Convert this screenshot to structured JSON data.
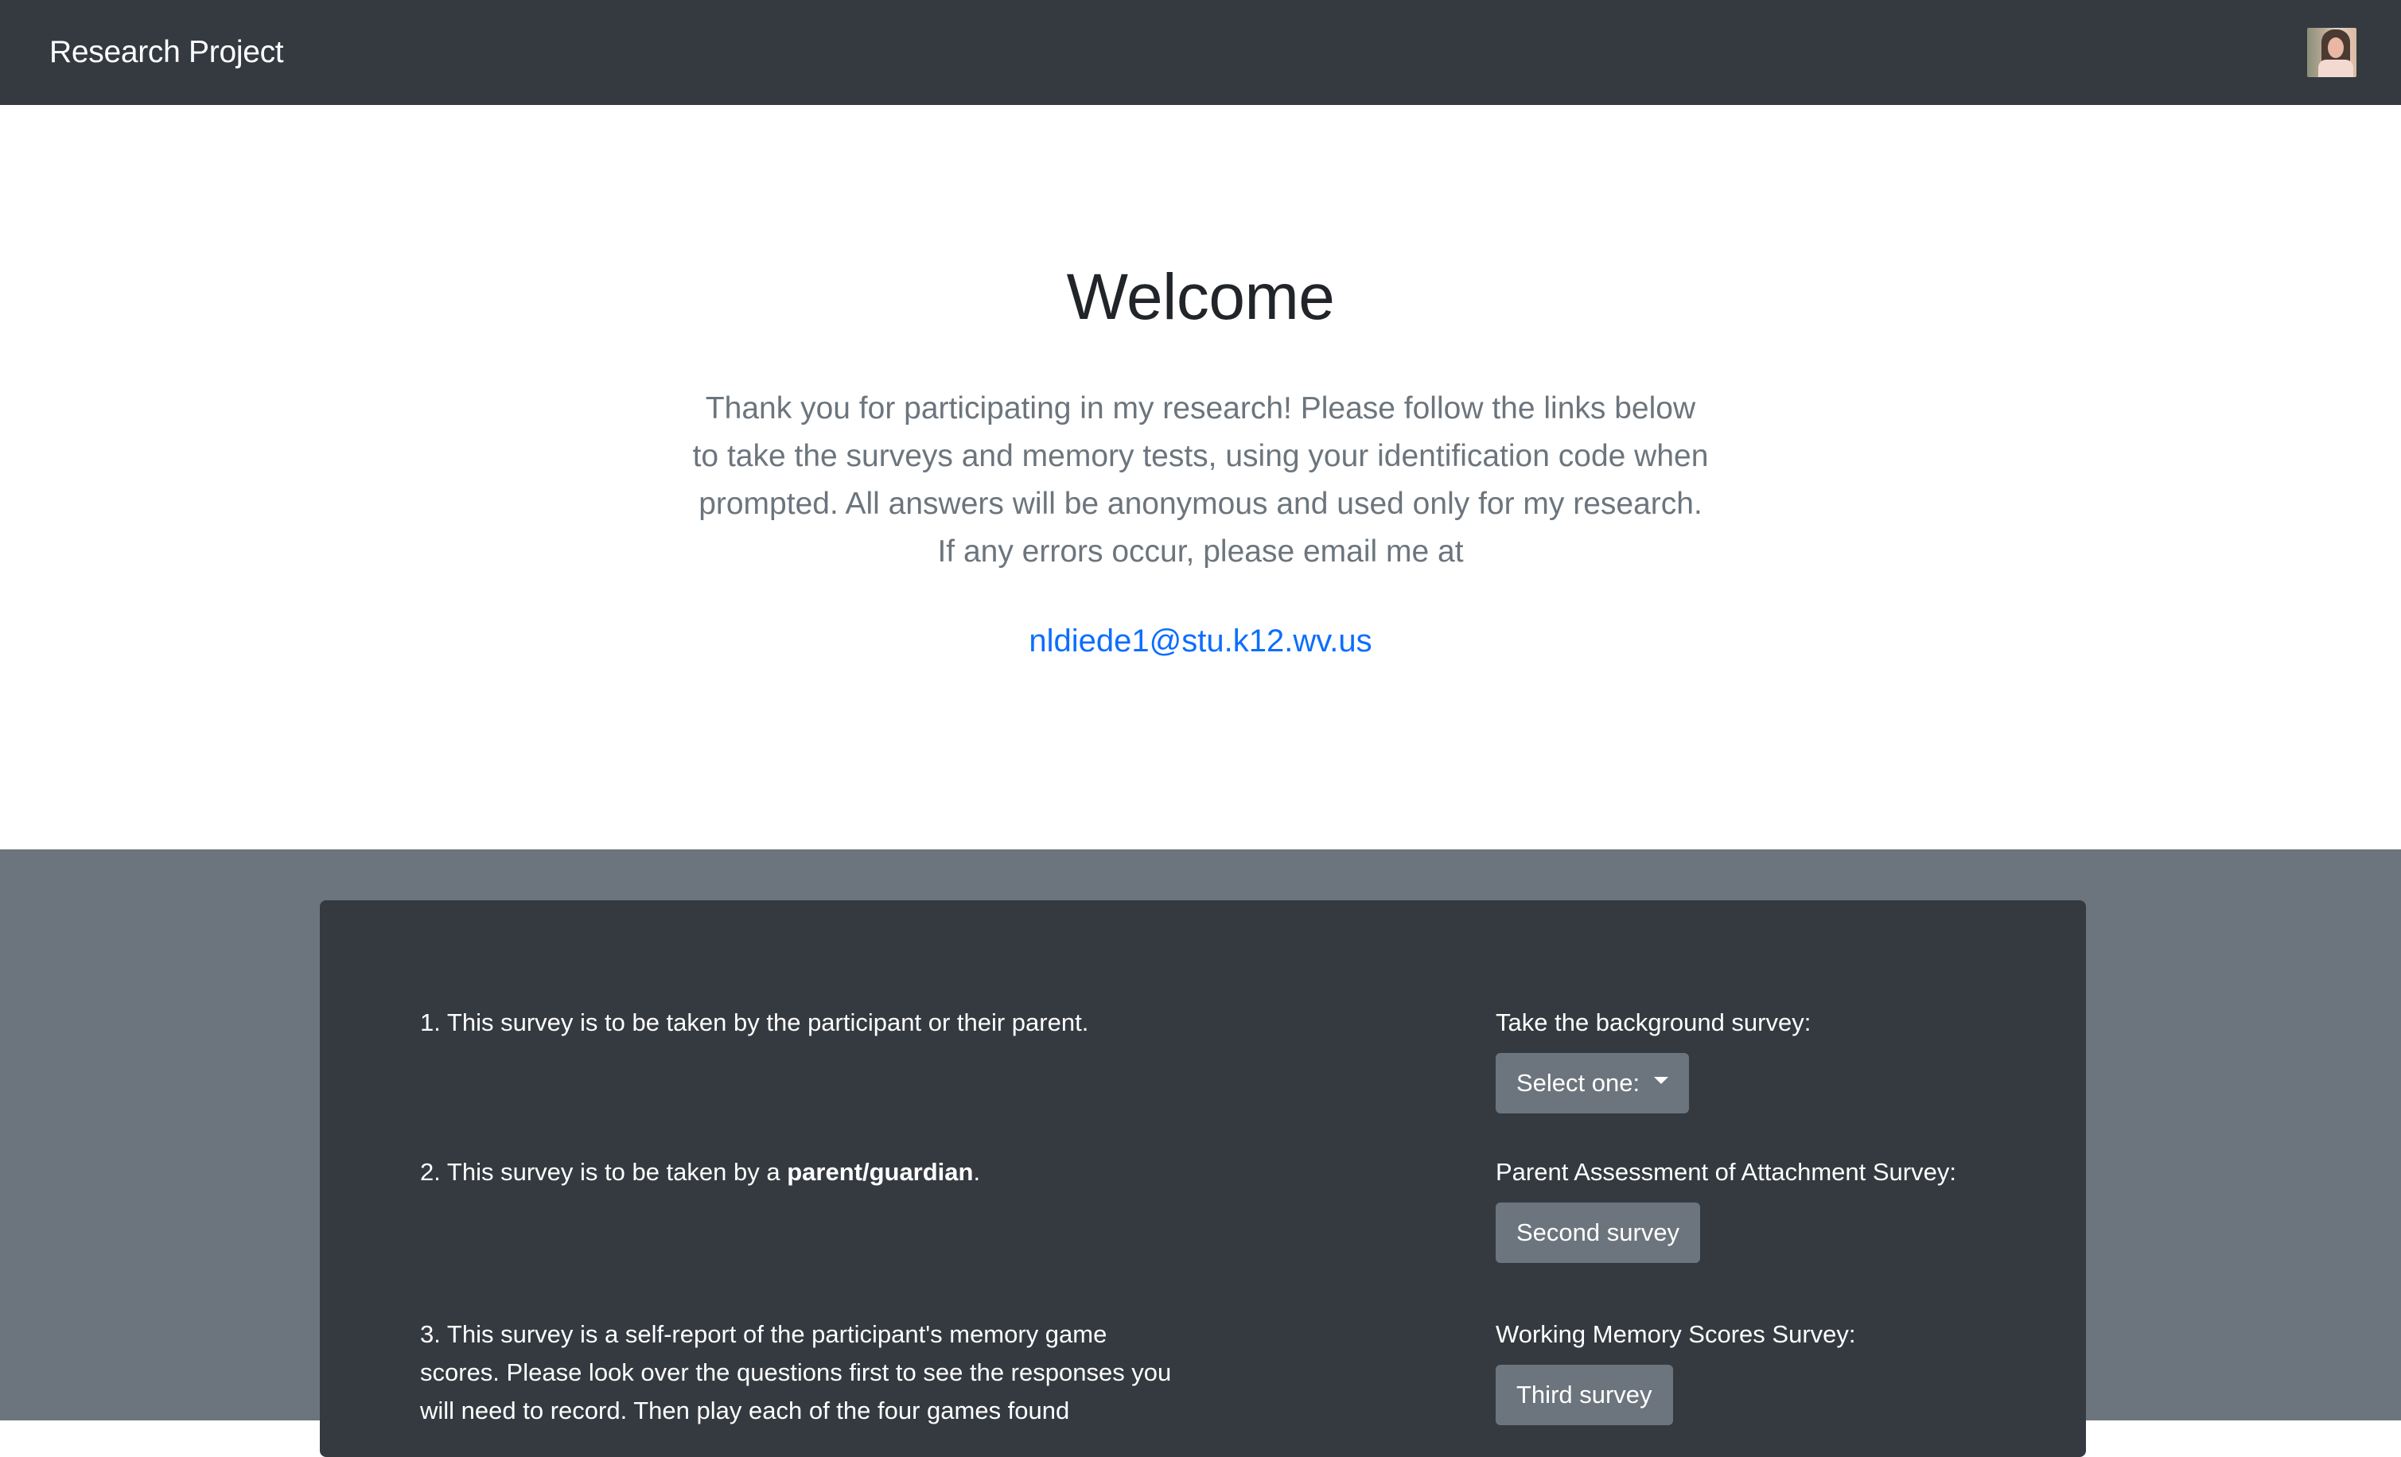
{
  "navbar": {
    "brand": "Research Project"
  },
  "hero": {
    "title": "Welcome",
    "lead": "Thank you for participating in my research! Please follow the links below to take the surveys and memory tests, using your identification code when prompted. All answers will be anonymous and used only for my research. If any errors occur, please email me at",
    "email": "nldiede1@stu.k12.wv.us"
  },
  "surveys": {
    "rows": [
      {
        "description": "1. This survey is to be taken by the participant or their parent.",
        "label": "Take the background survey:",
        "button": "Select one:"
      },
      {
        "description_prefix": "2. This survey is to be taken by a ",
        "description_bold": "parent/guardian",
        "description_suffix": ".",
        "label": "Parent Assessment of Attachment Survey:",
        "button": "Second survey"
      },
      {
        "description": "3. This survey is a self-report of the participant's memory game scores. Please look over the questions first to see the responses you will need to record. Then play each of the four games found",
        "label": "Working Memory Scores Survey:",
        "button": "Third survey"
      }
    ]
  },
  "colors": {
    "navbar_bg": "#343a40",
    "section_bg": "#6c757d",
    "card_bg": "#343a40",
    "button_bg": "#6c757d",
    "link": "#0d6efd",
    "lead_text": "#6c757d"
  }
}
